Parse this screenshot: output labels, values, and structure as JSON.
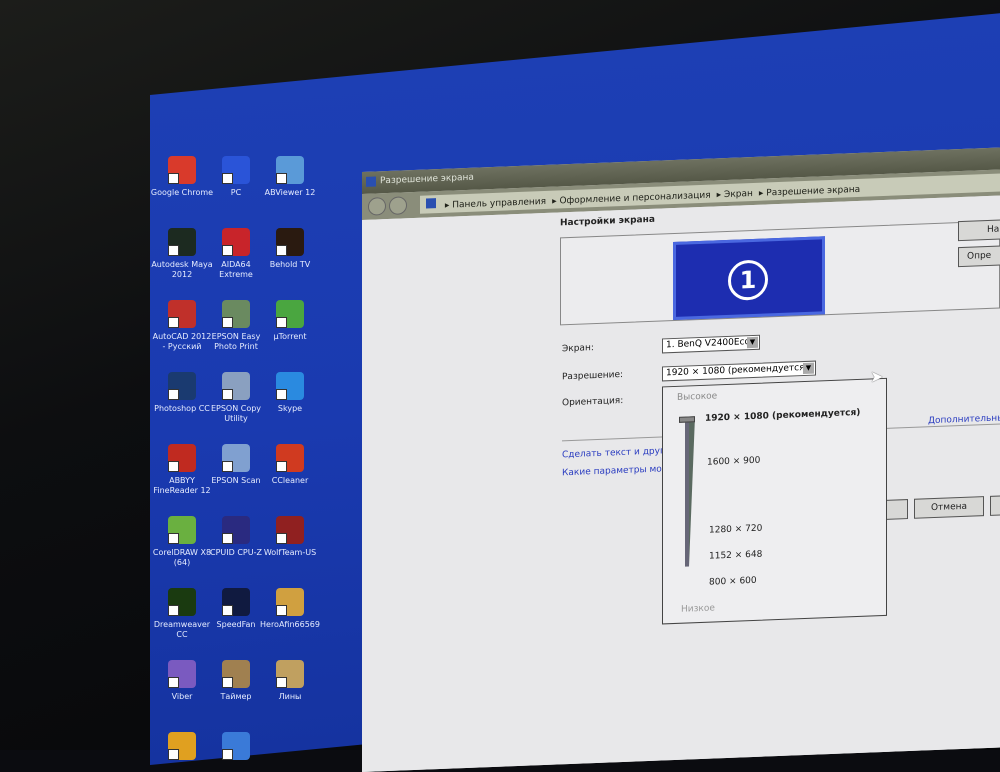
{
  "desktop": {
    "icons": [
      [
        "Google Chrome",
        "#d93a2b"
      ],
      [
        "PC",
        "#2a54d8"
      ],
      [
        "ABViewer 12",
        "#5a9ad8"
      ],
      [
        "Autodesk Maya 2012",
        "#1c2a20"
      ],
      [
        "AIDA64 Extreme",
        "#c8242a"
      ],
      [
        "Behold TV",
        "#2a1a10"
      ],
      [
        "AutoCAD 2012 - Русский",
        "#c0302a"
      ],
      [
        "EPSON Easy Photo Print",
        "#6a8a60"
      ],
      [
        "µTorrent",
        "#4aa640"
      ],
      [
        "Photoshop CC",
        "#1a3a70"
      ],
      [
        "EPSON Copy Utility",
        "#8aa0c0"
      ],
      [
        "Skype",
        "#2a8ae0"
      ],
      [
        "ABBYY FineReader 12",
        "#c02a20"
      ],
      [
        "EPSON Scan",
        "#80a0d0"
      ],
      [
        "CCleaner",
        "#d03a20"
      ],
      [
        "CorelDRAW X8 (64)",
        "#6ab040"
      ],
      [
        "CPUID CPU-Z",
        "#2a2a80"
      ],
      [
        "WolfTeam-US",
        "#902020"
      ],
      [
        "Dreamweaver CC",
        "#1a3a10"
      ],
      [
        "SpeedFan",
        "#101a40"
      ],
      [
        "HeroAfin66569",
        "#d0a040"
      ],
      [
        "Viber",
        "#7a5ac0"
      ],
      [
        "Таймер",
        "#a08050"
      ],
      [
        "Лины",
        "#c0a060"
      ],
      [
        "",
        "#e0a020"
      ],
      [
        "",
        "#3a7ad8"
      ]
    ]
  },
  "window": {
    "title": "Разрешение экрана",
    "breadcrumbs": [
      "Панель управления",
      "Оформление и персонализация",
      "Экран",
      "Разрешение экрана"
    ],
    "heading": "Настройки экрана",
    "monitor_number": "1",
    "find_button": "На",
    "detect_button": "Опре",
    "labels": {
      "screen": "Экран:",
      "resolution": "Разрешение:",
      "orientation": "Ориентация:"
    },
    "screen_value": "1. BenQ V2400Eco",
    "resolution_value": "1920 × 1080 (рекомендуется)",
    "links": [
      "Сделать текст и другие",
      "Какие параметры монит",
      "Дополнительны"
    ],
    "cancel_button": "Отмена",
    "dropdown": {
      "high": "Высокое",
      "low": "Низкое",
      "options": [
        "1920 × 1080 (рекомендуется)",
        "1600 × 900",
        "1280 × 720",
        "1152 × 648",
        "800 × 600"
      ],
      "slider_position_percent": 100
    }
  }
}
